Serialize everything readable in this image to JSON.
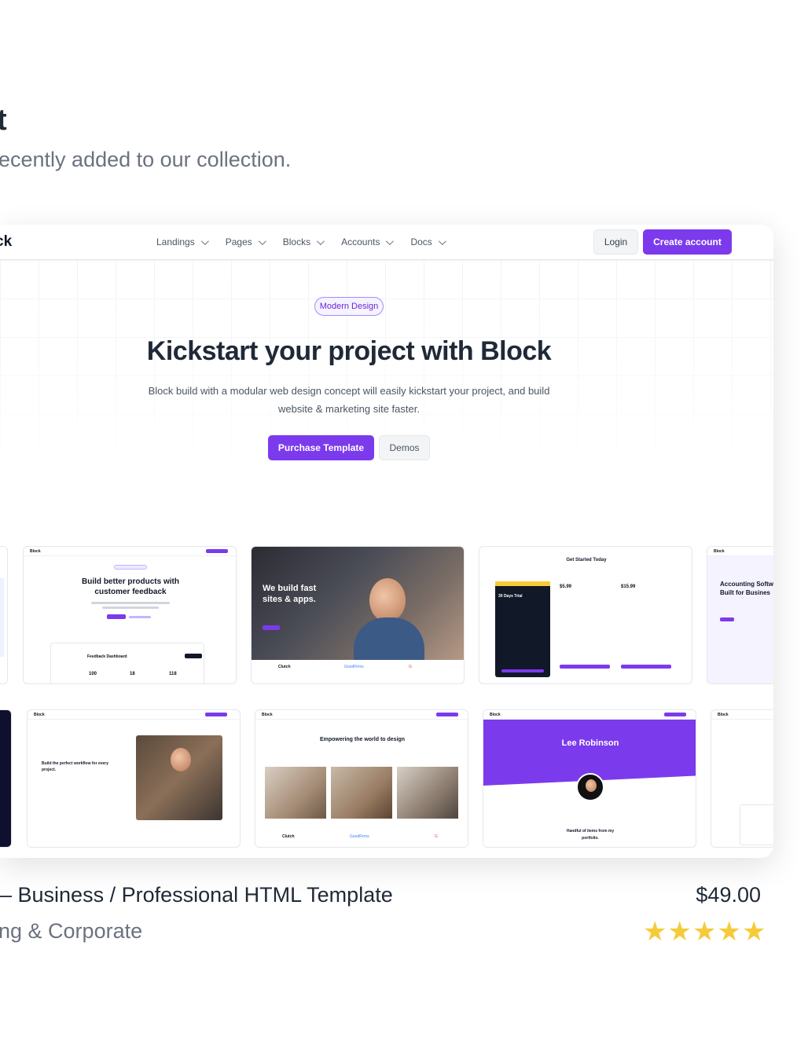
{
  "section": {
    "title": "t",
    "subtitle": "ecently added to our collection."
  },
  "preview": {
    "nav": {
      "logo": "ck",
      "menu": [
        "Landings",
        "Pages",
        "Blocks",
        "Accounts",
        "Docs"
      ],
      "login": "Login",
      "create_account": "Create account"
    },
    "hero": {
      "badge": "Modern Design",
      "title": "Kickstart your project with Block",
      "description": "Block build with a modular web design concept will easily kickstart your project, and build website & marketing site faster.",
      "purchase": "Purchase Template",
      "demos": "Demos"
    },
    "thumbnails": {
      "feedback_title": "Build better products with customer feedback",
      "apps_title": "We build fast sites & apps.",
      "pricing_title": "Get Started Today",
      "pricing_trial": "30 Days Trial",
      "price_pro": "$5.99",
      "price_premium": "$15.99",
      "accounting_title": "Accounting Softw Built for Busines",
      "workflow_title": "Build the perfect workflow for every project.",
      "empower_title": "Empowering the world to design",
      "profile_name": "Lee Robinson",
      "portfolio_text": "Handful of items from my portfolio.",
      "block_logo": "Block"
    }
  },
  "product": {
    "title": "– Business / Professional HTML Template",
    "category": "ng & Corporate",
    "price": "$49.00",
    "rating": 5,
    "colors": {
      "accent": "#7c3aed",
      "star": "#f5cb3a"
    }
  }
}
